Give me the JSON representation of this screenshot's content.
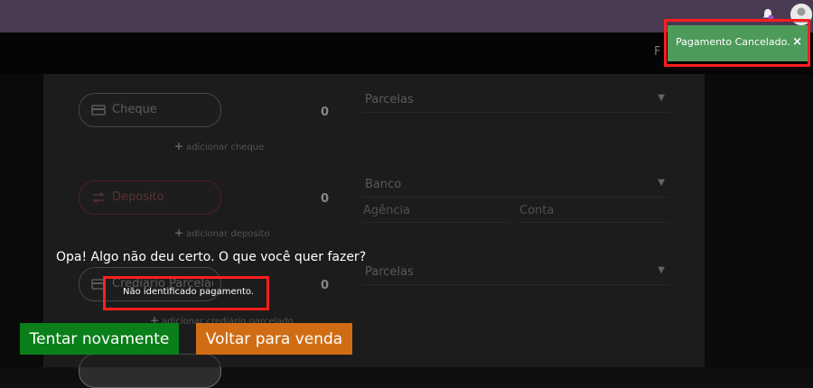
{
  "navbar": {
    "partial_label": "F"
  },
  "payments": [
    {
      "label": "Cheque",
      "amount": "0",
      "add_label": "adicionar cheque",
      "select_placeholder": "Parcelas"
    },
    {
      "label": "Deposito",
      "amount": "0",
      "add_label": "adicionar deposito",
      "bank_placeholder": "Banco",
      "agency_placeholder": "Agência",
      "account_placeholder": "Conta"
    },
    {
      "label": "Crediário Parcelado",
      "amount": "0",
      "add_label": "adicionar crediário parcelado",
      "select_placeholder": "Parcelas"
    }
  ],
  "toast": {
    "message": "Pagamento Cancelado.",
    "close": "×",
    "color": "#4e9a5a"
  },
  "dialog": {
    "title": "Opa! Algo não deu certo. O que você quer fazer?",
    "message": "Não identificado pagamento.",
    "retry_label": "Tentar novamente",
    "back_label": "Voltar para venda",
    "retry_color": "#0b7f1a",
    "back_color": "#d06d14"
  },
  "icons": {
    "notification": "bell-icon",
    "user": "avatar-icon",
    "cheque": "card-icon",
    "deposit": "transfer-icon"
  }
}
